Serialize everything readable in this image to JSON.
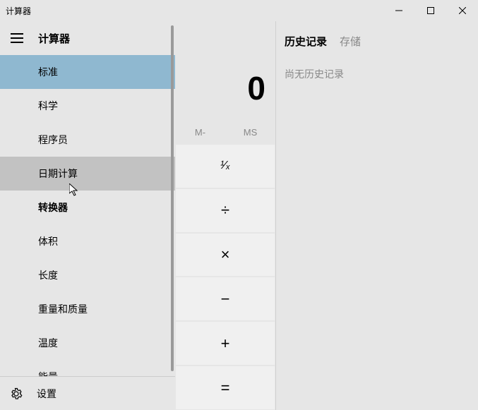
{
  "window": {
    "title": "计算器"
  },
  "sidebar": {
    "title": "计算器",
    "items": [
      {
        "label": "标准"
      },
      {
        "label": "科学"
      },
      {
        "label": "程序员"
      },
      {
        "label": "日期计算"
      }
    ],
    "converterHeader": "转换器",
    "converters": [
      {
        "label": "体积"
      },
      {
        "label": "长度"
      },
      {
        "label": "重量和质量"
      },
      {
        "label": "温度"
      },
      {
        "label": "能量"
      }
    ],
    "settings": "设置"
  },
  "calc": {
    "display": "0",
    "memory": {
      "minus": "M-",
      "store": "MS"
    },
    "ops": {
      "reciprocal": "¹⁄ₓ",
      "divide": "÷",
      "multiply": "×",
      "minus": "−",
      "plus": "+",
      "equals": "="
    }
  },
  "history": {
    "tabHistory": "历史记录",
    "tabMemory": "存储",
    "empty": "尚无历史记录"
  }
}
